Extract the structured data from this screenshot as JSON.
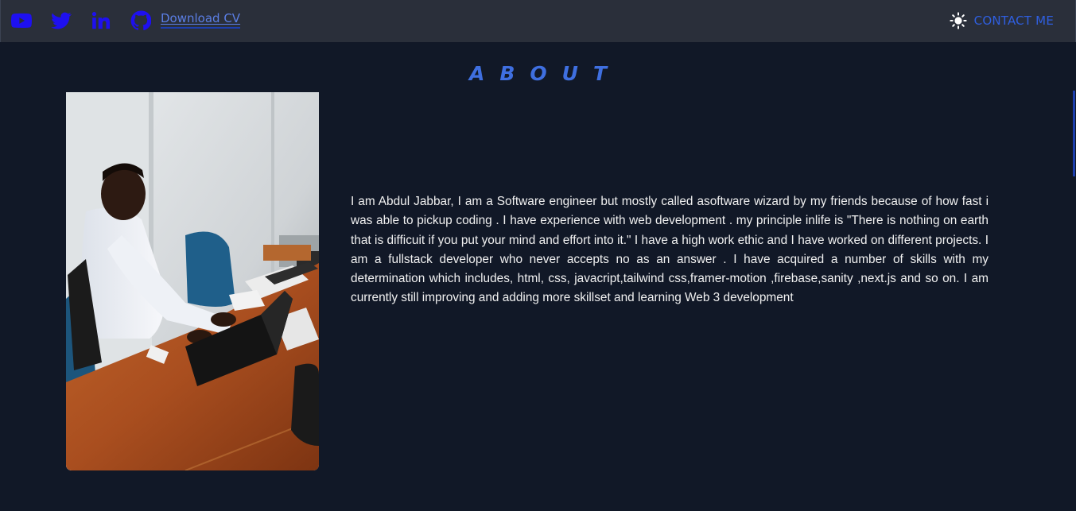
{
  "header": {
    "social_icons": [
      "youtube-icon",
      "twitter-icon",
      "linkedin-icon",
      "github-icon"
    ],
    "download_cv_label": "Download CV",
    "theme_icon": "sun-icon",
    "contact_label": "CONTACT ME"
  },
  "about": {
    "title": "ABOUT",
    "bio": "I am Abdul Jabbar, I am a Software engineer but mostly called asoftware wizard by my friends because of how fast i was able to pickup coding . I have experience with web development . my principle inlife is \"There is nothing on earth that is difficuit if you put your mind and effort into it.\" I have a high work ethic and I have worked on different projects. I am a fullstack developer who never accepts no as an answer . I have acquired a number of skills with my determination which includes, html, css, javacript,tailwind css,framer-motion ,firebase,sanity ,next.js and so on. I am currently still improving and adding more skillset and learning Web 3 development"
  },
  "colors": {
    "background": "#111827",
    "header_background": "#2a2f3a",
    "icon_blue": "#1e10f0",
    "accent": "#3f6fe0",
    "bio_text": "#f1f1f1"
  }
}
